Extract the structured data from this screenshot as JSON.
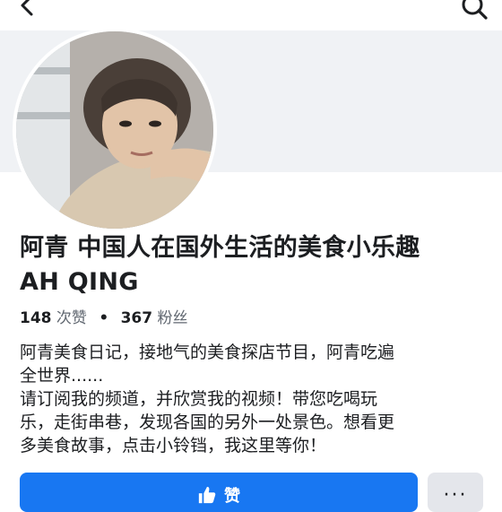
{
  "header": {
    "back_icon": "chevron-left-icon",
    "search_icon": "search-icon"
  },
  "profile": {
    "title_line1": "阿青 中国人在国外生活的美食小乐趣",
    "title_line2": "AH QING",
    "likes_count": "148",
    "likes_unit": "次赞",
    "followers_count": "367",
    "followers_unit": "粉丝",
    "separator": "•"
  },
  "bio": {
    "lines": [
      "阿青美食日记，接地气的美食探店节目，阿青吃遍",
      "全世界......",
      "请订阅我的频道，并欣赏我的视频！带您吃喝玩",
      "乐，走街串巷，发现各国的另外一处景色。想看更",
      "多美食故事，点击小铃铛，我这里等你！"
    ]
  },
  "actions": {
    "like_label": "赞",
    "like_icon": "thumbs-up-icon",
    "more_label": "···"
  },
  "colors": {
    "accent": "#1877f2",
    "cover_bg": "#f0f2f5",
    "secondary_button": "#e4e6eb"
  }
}
